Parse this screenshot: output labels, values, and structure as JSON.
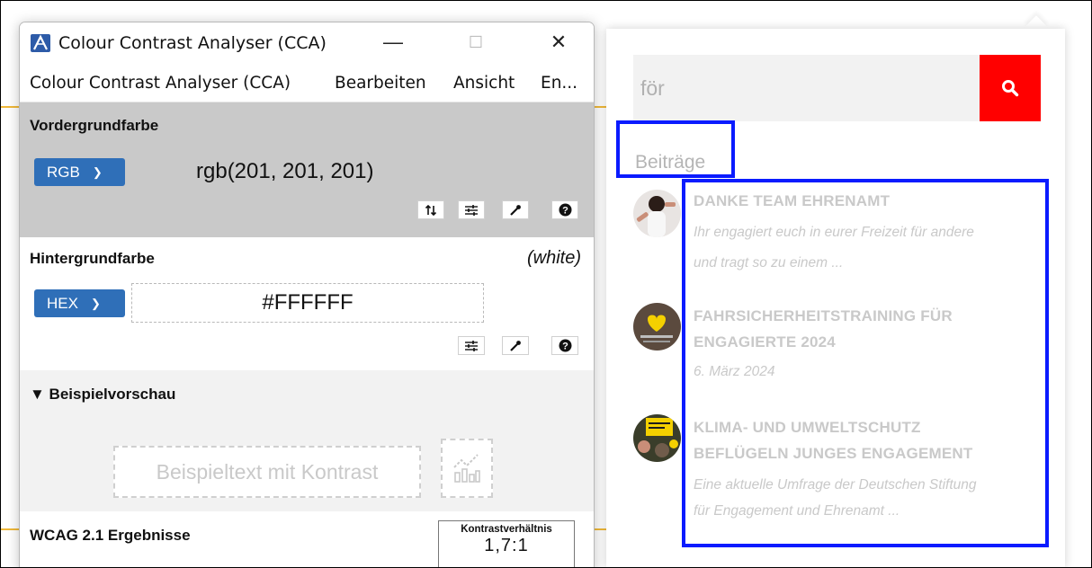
{
  "cca": {
    "window_title": "Colour Contrast Analyser (CCA)",
    "window_controls": {
      "minimize": "—",
      "maximize": "☐",
      "close": "✕"
    },
    "menu": [
      "Colour Contrast Analyser (CCA)",
      "Bearbeiten",
      "Ansicht",
      "En..."
    ],
    "foreground": {
      "heading": "Vordergrundfarbe",
      "format": "RGB",
      "value": "rgb(201, 201, 201)",
      "color": "#c9c9c9",
      "tools": [
        "swap-icon",
        "sliders-icon",
        "eyedropper-icon",
        "help-icon"
      ]
    },
    "background": {
      "heading": "Hintergrundfarbe",
      "name": "(white)",
      "format": "HEX",
      "value": "#FFFFFF",
      "color": "#ffffff",
      "tools": [
        "sliders-icon",
        "eyedropper-icon",
        "help-icon"
      ]
    },
    "preview": {
      "heading": "▼ Beispielvorschau",
      "sample_text": "Beispieltext mit Kontrast"
    },
    "wcag": {
      "heading": "WCAG 2.1 Ergebnisse",
      "ratio_label": "Kontrastverhältnis",
      "ratio_value": "1,7:1"
    }
  },
  "search": {
    "query": "för",
    "button_icon": "search-icon",
    "button_color": "#ff0000",
    "section_label": "Beiträge",
    "results": [
      {
        "title_lines": [
          "DANKE TEAM EHRENAMT"
        ],
        "sub_lines": [
          "Ihr engagiert euch in eurer Freizeit für andere",
          "und tragt so zu einem ..."
        ]
      },
      {
        "title_lines": [
          "FAHRSICHERHEITSTRAINING FÜR",
          "ENGAGIERTE 2024"
        ],
        "sub_lines": [
          "6. März 2024"
        ]
      },
      {
        "title_lines": [
          "KLIMA- UND UMWELTSCHUTZ",
          "BEFLÜGELN JUNGES ENGAGEMENT"
        ],
        "sub_lines": [
          "Eine aktuelle Umfrage der Deutschen Stiftung",
          "für Engagement und Ehrenamt ..."
        ]
      }
    ]
  },
  "colors": {
    "highlight": "#0a1bff",
    "accent_line": "#f0b93a",
    "text_low_contrast": "#c9c9c9"
  }
}
